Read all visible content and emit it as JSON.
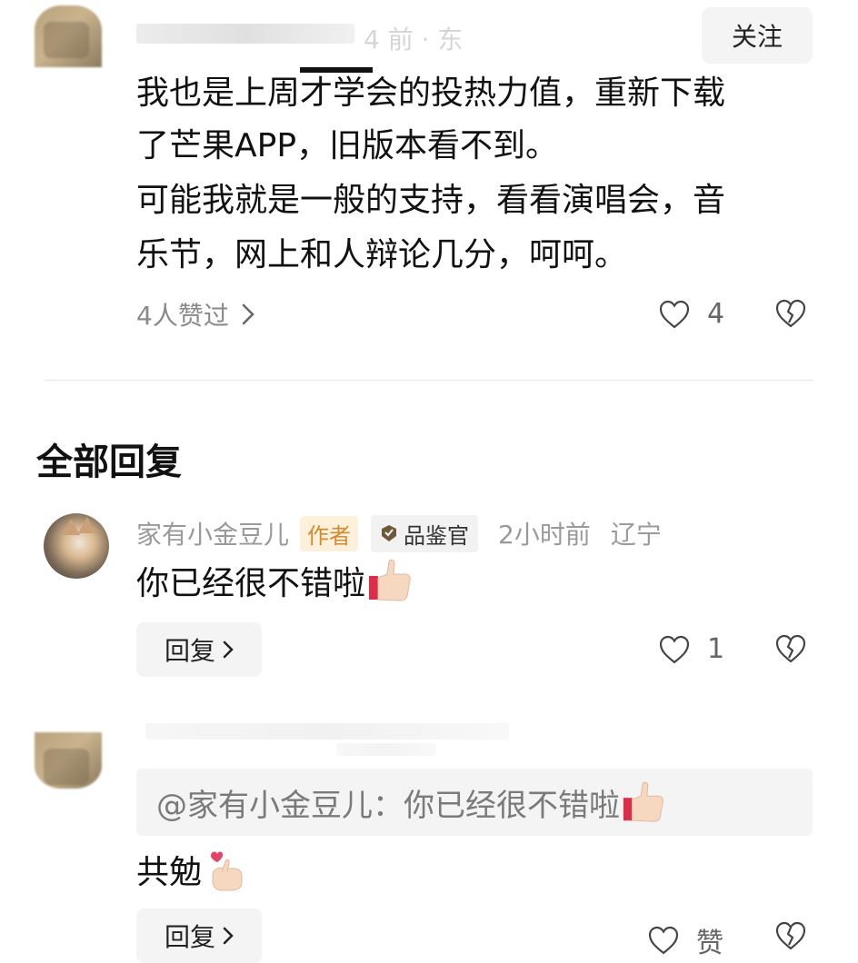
{
  "top_comment": {
    "time_location_partial": "4 前 · 东",
    "follow_label": "关注",
    "text_line1": "我也是上周才学会的投热力值，重新下载",
    "text_line2": "了芒果APP，旧版本看不到。",
    "text_line3": "可能我就是一般的支持，看看演唱会，音",
    "text_line4": "乐节，网上和人辩论几分，呵呵。",
    "likers_label": "4人赞过",
    "like_count": "4"
  },
  "replies_section": {
    "title": "全部回复"
  },
  "reply1": {
    "username": "家有小金豆儿",
    "author_tag": "作者",
    "critic_tag": "品鉴官",
    "time": "2小时前",
    "location": "辽宁",
    "text": "你已经很不错啦",
    "reply_label": "回复",
    "like_count": "1"
  },
  "reply2": {
    "quote": "@家有小金豆儿：你已经很不错啦",
    "text": "共勉",
    "reply_label": "回复",
    "like_label": "赞"
  }
}
